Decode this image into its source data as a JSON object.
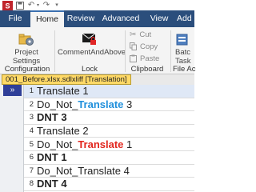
{
  "quick_access": {
    "icons": [
      "app-logo-icon",
      "save-icon",
      "undo-icon",
      "redo-icon",
      "customize-icon"
    ]
  },
  "ribbon": {
    "tabs": [
      {
        "label": "File",
        "active": false
      },
      {
        "label": "Home",
        "active": true
      },
      {
        "label": "Review",
        "active": false
      },
      {
        "label": "Advanced",
        "active": false
      },
      {
        "label": "View",
        "active": false
      },
      {
        "label": "Add",
        "active": false
      }
    ],
    "buttons": {
      "project_settings": "Project Settings",
      "comment_and_above": "CommentAndAbove",
      "cut": "Cut",
      "copy": "Copy",
      "paste": "Paste",
      "batch_tasks": "Batc Task"
    },
    "groups": {
      "configuration": "Configuration",
      "lock": "Lock",
      "clipboard": "Clipboard",
      "file_actions": "File Ac"
    }
  },
  "document_tab": {
    "label": "001_Before.xlsx.sdlxliff [Translation]"
  },
  "editor": {
    "collapse_glyph": "»",
    "rows": [
      {
        "num": "1",
        "selected": true,
        "bold": false,
        "before": "Translate 1",
        "highlight": "",
        "highlight_color": "",
        "after": ""
      },
      {
        "num": "2",
        "selected": false,
        "bold": false,
        "before": "Do_Not_",
        "highlight": "Translate",
        "highlight_color": "#1f8fdb",
        "after": " 3"
      },
      {
        "num": "3",
        "selected": false,
        "bold": true,
        "before": "DNT 3",
        "highlight": "",
        "highlight_color": "",
        "after": ""
      },
      {
        "num": "4",
        "selected": false,
        "bold": false,
        "before": "Translate 2",
        "highlight": "",
        "highlight_color": "",
        "after": ""
      },
      {
        "num": "5",
        "selected": false,
        "bold": false,
        "before": "Do_Not_",
        "highlight": "Translate",
        "highlight_color": "#e2241c",
        "after": " 1"
      },
      {
        "num": "6",
        "selected": false,
        "bold": true,
        "before": "DNT 1",
        "highlight": "",
        "highlight_color": "",
        "after": ""
      },
      {
        "num": "7",
        "selected": false,
        "bold": false,
        "before": "Do_Not_Translate 4",
        "highlight": "",
        "highlight_color": "",
        "after": ""
      },
      {
        "num": "8",
        "selected": false,
        "bold": true,
        "before": "DNT 4",
        "highlight": "",
        "highlight_color": "",
        "after": ""
      }
    ]
  },
  "colors": {
    "ribbon_tab_bar": "#2b4e7c",
    "active_tab": "#f4f4f4",
    "document_tab": "#ffd966",
    "collapse_button": "#2f3f98",
    "selected_row": "#dfe8f6"
  }
}
